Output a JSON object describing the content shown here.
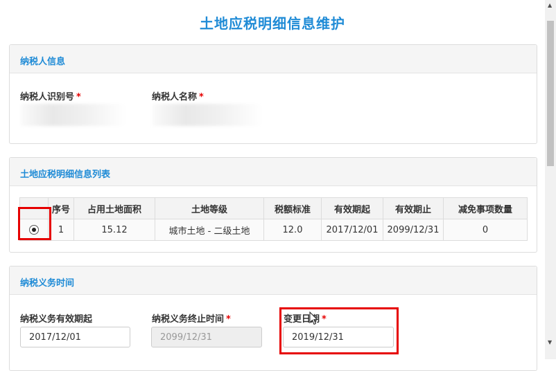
{
  "page_title": "土地应税明细信息维护",
  "taxpayer": {
    "section_title": "纳税人信息",
    "id_label": "纳税人识别号",
    "name_label": "纳税人名称",
    "required": "*"
  },
  "land_list": {
    "section_title": "土地应税明细信息列表",
    "columns": [
      "序号",
      "占用土地面积",
      "土地等级",
      "税额标准",
      "有效期起",
      "有效期止",
      "减免事项数量"
    ],
    "rows": [
      {
        "seq": "1",
        "area": "15.12",
        "grade": "城市土地 - 二级土地",
        "rate": "12.0",
        "start": "2017/12/01",
        "end": "2099/12/31",
        "reliefs": "0"
      }
    ]
  },
  "obligation": {
    "section_title": "纳税义务时间",
    "start_label": "纳税义务有效期起",
    "end_label": "纳税义务终止时间",
    "change_label": "变更日期",
    "start_value": "2017/12/01",
    "end_value": "2099/12/31",
    "change_value": "2019/12/31",
    "required": "*"
  },
  "colors": {
    "accent": "#1f8bd6",
    "highlight": "#e60000",
    "required": "#e60000"
  }
}
